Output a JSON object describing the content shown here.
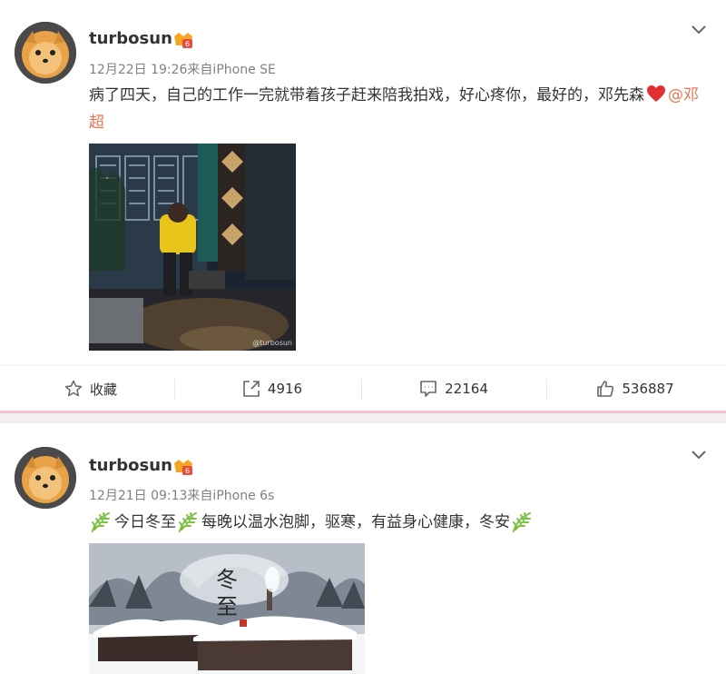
{
  "posts": [
    {
      "username": "turbosun",
      "meta": "12月22日 19:26来自iPhone SE",
      "text_before_heart": "病了四天，自己的工作一完就带着孩子赶来陪我拍戏，好心疼你，最好的，邓先森",
      "mention": "@邓超",
      "photo_watermark": "@turbosun",
      "actions": {
        "favorite_label": "收藏",
        "repost_count": "4916",
        "comment_count": "22164",
        "like_count": "536887"
      }
    },
    {
      "username": "turbosun",
      "meta": "12月21日 09:13来自iPhone 6s",
      "text_part_1": "今日冬至",
      "text_part_2": "每晚以温水泡脚，驱寒，有益身心健康，冬安",
      "photo_title": "冬至"
    }
  ],
  "colors": {
    "mention": "#eb7350",
    "separator": "#f1c2cd",
    "meta": "#808080"
  },
  "icons": [
    "chevron-down-icon",
    "vip-badge-icon",
    "heart-emoji-icon",
    "leaf-emoji-icon",
    "star-icon",
    "repost-icon",
    "comment-icon",
    "like-icon"
  ]
}
